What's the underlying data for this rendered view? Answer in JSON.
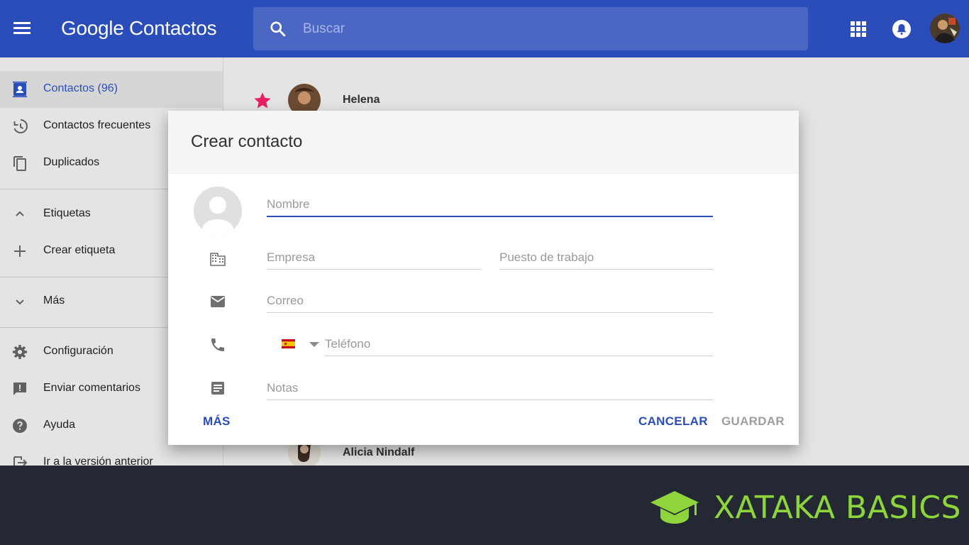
{
  "header": {
    "app_title": "Google Contactos",
    "search_placeholder": "Buscar",
    "icons": [
      "menu-icon",
      "search-icon",
      "apps-icon",
      "notifications-icon",
      "account-avatar"
    ]
  },
  "sidebar": {
    "items": [
      {
        "label": "Contactos (96)",
        "icon": "contacts-icon",
        "active": true
      },
      {
        "label": "Contactos frecuentes",
        "icon": "history-icon"
      },
      {
        "label": "Duplicados",
        "icon": "duplicate-icon"
      },
      {
        "label": "Etiquetas",
        "icon": "chevron-up-icon"
      },
      {
        "label": "Crear etiqueta",
        "icon": "plus-icon"
      },
      {
        "label": "Más",
        "icon": "chevron-down-icon"
      },
      {
        "label": "Configuración",
        "icon": "gear-icon"
      },
      {
        "label": "Enviar comentarios",
        "icon": "feedback-icon"
      },
      {
        "label": "Ayuda",
        "icon": "help-icon"
      },
      {
        "label": "Ir a la versión anterior",
        "icon": "exit-icon"
      }
    ]
  },
  "contacts": [
    {
      "name": "Helena",
      "starred": true
    },
    {
      "name": "Alicia Nindalf",
      "starred": false
    }
  ],
  "dialog": {
    "title": "Crear contacto",
    "fields": {
      "name_placeholder": "Nombre",
      "company_placeholder": "Empresa",
      "job_placeholder": "Puesto de trabajo",
      "email_placeholder": "Correo",
      "phone_placeholder": "Teléfono",
      "notes_placeholder": "Notas"
    },
    "phone_country": "ES",
    "buttons": {
      "more": "MÁS",
      "cancel": "CANCELAR",
      "save": "GUARDAR"
    }
  },
  "branding": {
    "text": "XATAKA BASICS"
  },
  "colors": {
    "primary": "#2b4db9",
    "star": "#e91e63",
    "brand_green": "#8ed53c",
    "footer_bg": "#232833"
  }
}
